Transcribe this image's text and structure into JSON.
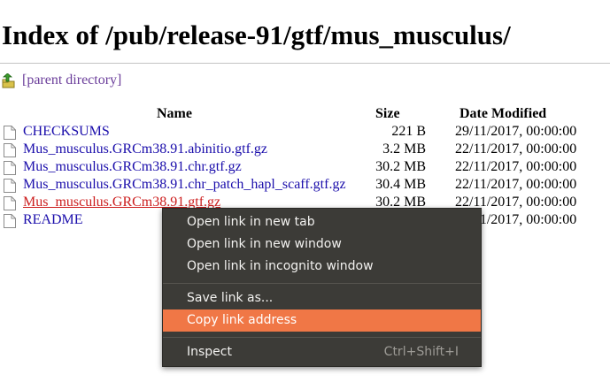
{
  "page": {
    "title": "Index of /pub/release-91/gtf/mus_musculus/",
    "parent_label": "[parent directory]"
  },
  "table": {
    "headers": {
      "name": "Name",
      "size": "Size",
      "date": "Date Modified"
    },
    "rows": [
      {
        "name": "CHECKSUMS",
        "size": "221 B",
        "date": "29/11/2017, 00:00:00"
      },
      {
        "name": "Mus_musculus.GRCm38.91.abinitio.gtf.gz",
        "size": "3.2 MB",
        "date": "22/11/2017, 00:00:00"
      },
      {
        "name": "Mus_musculus.GRCm38.91.chr.gtf.gz",
        "size": "30.2 MB",
        "date": "22/11/2017, 00:00:00"
      },
      {
        "name": "Mus_musculus.GRCm38.91.chr_patch_hapl_scaff.gtf.gz",
        "size": "30.4 MB",
        "date": "22/11/2017, 00:00:00"
      },
      {
        "name": "Mus_musculus.GRCm38.91.gtf.gz",
        "size": "30.2 MB",
        "date": "22/11/2017, 00:00:00"
      },
      {
        "name": "README",
        "size": "",
        "date": "22/11/2017, 00:00:00"
      }
    ]
  },
  "context_menu": {
    "items": [
      {
        "label": "Open link in new tab",
        "shortcut": ""
      },
      {
        "label": "Open link in new window",
        "shortcut": ""
      },
      {
        "label": "Open link in incognito window",
        "shortcut": ""
      },
      {
        "label": "Save link as...",
        "shortcut": ""
      },
      {
        "label": "Copy link address",
        "shortcut": ""
      },
      {
        "label": "Inspect",
        "shortcut": "Ctrl+Shift+I"
      }
    ],
    "highlighted_index": 4
  },
  "colors": {
    "link": "#1a0dab",
    "visited_link": "#6a3d9a",
    "active_link": "#cc1d1d",
    "menu_bg": "#3c3b37",
    "menu_highlight": "#f07746"
  },
  "icons": {
    "parent": "folder-up-arrow-icon",
    "file": "generic-file-icon"
  }
}
